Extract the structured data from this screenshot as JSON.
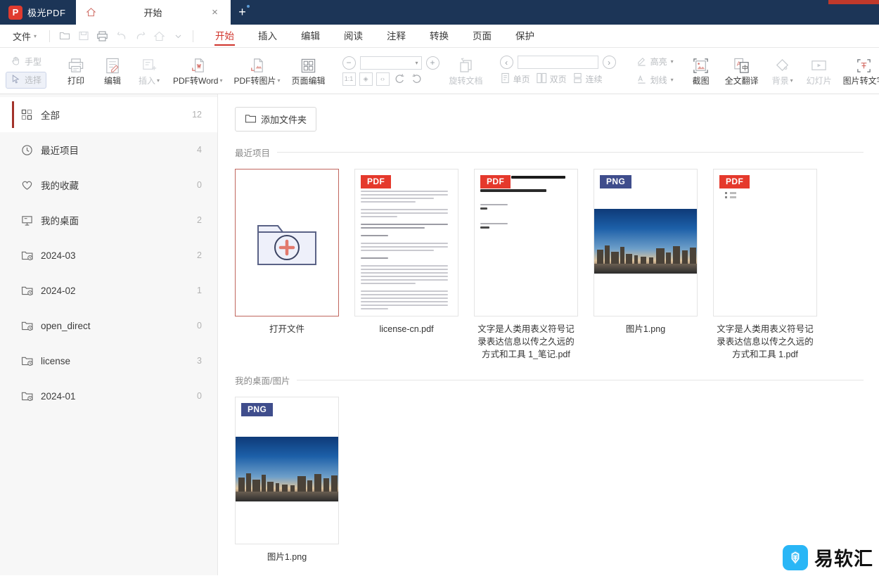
{
  "titlebar": {
    "brand_letter": "P",
    "brand_name": "极光PDF",
    "home_icon": "home-icon",
    "tab_title": "开始",
    "close_icon": "×",
    "new_tab_icon": "+"
  },
  "menubar": {
    "file_label": "文件",
    "quick_access": [
      {
        "name": "open-icon",
        "glyph": "open"
      },
      {
        "name": "save-icon",
        "glyph": "save"
      },
      {
        "name": "print-icon",
        "glyph": "print"
      },
      {
        "name": "undo-icon",
        "glyph": "undo"
      },
      {
        "name": "redo-icon",
        "glyph": "redo"
      },
      {
        "name": "home-icon",
        "glyph": "home"
      },
      {
        "name": "chevron-down-icon",
        "glyph": "caret"
      }
    ],
    "tabs": [
      {
        "label": "开始",
        "active": true
      },
      {
        "label": "插入",
        "active": false
      },
      {
        "label": "编辑",
        "active": false
      },
      {
        "label": "阅读",
        "active": false
      },
      {
        "label": "注释",
        "active": false
      },
      {
        "label": "转换",
        "active": false
      },
      {
        "label": "页面",
        "active": false
      },
      {
        "label": "保护",
        "active": false
      }
    ]
  },
  "ribbon": {
    "mode_tools": [
      {
        "label": "手型",
        "selected": false
      },
      {
        "label": "选择",
        "selected": true
      }
    ],
    "main_tools": [
      {
        "label": "打印",
        "disabled": false,
        "caret": false
      },
      {
        "label": "编辑",
        "disabled": false,
        "caret": false
      },
      {
        "label": "插入",
        "disabled": true,
        "caret": true
      },
      {
        "label": "PDF转Word",
        "disabled": false,
        "caret": true
      },
      {
        "label": "PDF转图片",
        "disabled": false,
        "caret": true
      },
      {
        "label": "页面编辑",
        "disabled": false,
        "caret": false
      }
    ],
    "zoom": {
      "minus": "−",
      "plus": "+",
      "value": "",
      "fit_buttons": [
        "1:1",
        "fit-page",
        "fit-width"
      ],
      "rotate_left": "rotate-left",
      "rotate_right": "rotate-right",
      "rotate_doc_label": "旋转文档"
    },
    "pager": {
      "prev": "‹",
      "next": "›",
      "value": "",
      "modes": [
        {
          "label": "单页"
        },
        {
          "label": "双页"
        },
        {
          "label": "连续"
        }
      ]
    },
    "annot_tools": [
      {
        "label": "高亮",
        "caret": true
      },
      {
        "label": "划线",
        "caret": true
      }
    ],
    "right_tools": [
      {
        "label": "截图",
        "disabled": false,
        "caret": false
      },
      {
        "label": "全文翻译",
        "disabled": false,
        "caret": false
      },
      {
        "label": "背景",
        "disabled": true,
        "caret": true
      },
      {
        "label": "幻灯片",
        "disabled": true,
        "caret": false
      },
      {
        "label": "图片转文字",
        "disabled": false,
        "caret": false
      }
    ]
  },
  "sidebar": {
    "items": [
      {
        "label": "全部",
        "count": "12",
        "icon": "grid-icon",
        "active": true
      },
      {
        "label": "最近项目",
        "count": "4",
        "icon": "clock-icon",
        "active": false
      },
      {
        "label": "我的收藏",
        "count": "0",
        "icon": "heart-icon",
        "active": false
      },
      {
        "label": "我的桌面",
        "count": "2",
        "icon": "monitor-icon",
        "active": false
      },
      {
        "label": "2024-03",
        "count": "2",
        "icon": "folder-clock-icon",
        "active": false
      },
      {
        "label": "2024-02",
        "count": "1",
        "icon": "folder-clock-icon",
        "active": false
      },
      {
        "label": "open_direct",
        "count": "0",
        "icon": "folder-clock-icon",
        "active": false
      },
      {
        "label": "license",
        "count": "3",
        "icon": "folder-clock-icon",
        "active": false
      },
      {
        "label": "2024-01",
        "count": "0",
        "icon": "folder-clock-icon",
        "active": false
      }
    ]
  },
  "content": {
    "add_folder_label": "添加文件夹",
    "sections": [
      {
        "title": "最近项目",
        "cards": [
          {
            "title": "打开文件",
            "kind": "open",
            "badge": ""
          },
          {
            "title": "license-cn.pdf",
            "kind": "doc",
            "badge": "PDF"
          },
          {
            "title": "文字是人类用表义符号记录表达信息以传之久远的方式和工具 1_笔记.pdf",
            "kind": "note",
            "badge": "PDF"
          },
          {
            "title": "图片1.png",
            "kind": "image",
            "badge": "PNG"
          },
          {
            "title": "文字是人类用表义符号记录表达信息以传之久远的方式和工具 1.pdf",
            "kind": "blank",
            "badge": "PDF"
          }
        ]
      },
      {
        "title": "我的桌面/图片",
        "cards": [
          {
            "title": "图片1.png",
            "kind": "image",
            "badge": "PNG"
          }
        ]
      }
    ]
  },
  "watermark": {
    "text": "易软汇",
    "mark_color": "#29b6f6"
  },
  "colors": {
    "titlebar_bg": "#1c3557",
    "accent_red": "#d0342c",
    "pdf_badge": "#e5392c",
    "png_badge": "#3f4d8c",
    "sidebar_bg": "#f7f7f7"
  }
}
